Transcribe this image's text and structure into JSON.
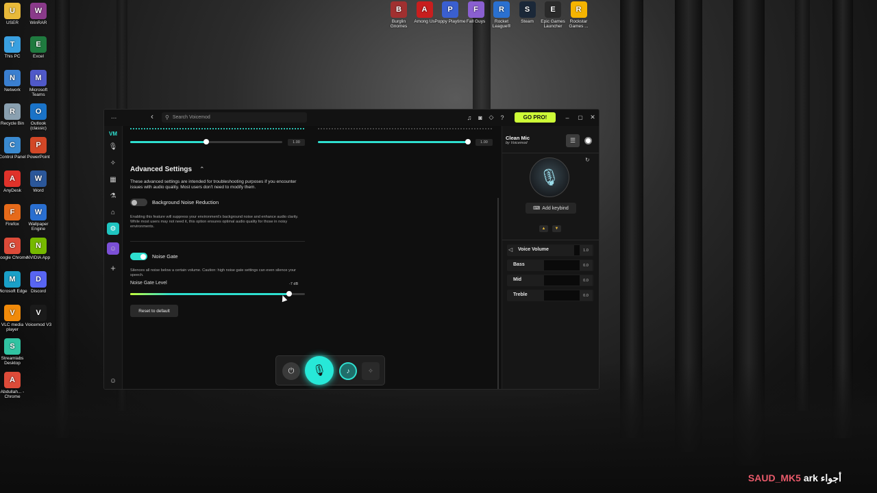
{
  "desktop": {
    "left_icons": [
      {
        "label": "USER",
        "glyph": "folder-icon",
        "color": "#e8b93a"
      },
      {
        "label": "WinRAR",
        "glyph": "winrar-icon",
        "color": "#8a3a8a"
      },
      {
        "label": "This PC",
        "glyph": "monitor-icon",
        "color": "#3aa0e0"
      },
      {
        "label": "Excel",
        "glyph": "excel-icon",
        "color": "#1f7a3f"
      },
      {
        "label": "Network",
        "glyph": "network-icon",
        "color": "#3a7fd0"
      },
      {
        "label": "Microsoft Teams",
        "glyph": "teams-icon",
        "color": "#5059c9"
      },
      {
        "label": "Recycle Bin",
        "glyph": "recycle-bin-icon",
        "color": "#8aa0b0"
      },
      {
        "label": "Outlook (classic)",
        "glyph": "outlook-icon",
        "color": "#1a73c8"
      },
      {
        "label": "Control Panel",
        "glyph": "control-panel-icon",
        "color": "#3a8ad0"
      },
      {
        "label": "PowerPoint",
        "glyph": "powerpoint-icon",
        "color": "#d24726"
      },
      {
        "label": "AnyDesk",
        "glyph": "anydesk-icon",
        "color": "#e0322a"
      },
      {
        "label": "Word",
        "glyph": "word-icon",
        "color": "#2b579a"
      },
      {
        "label": "Firefox",
        "glyph": "firefox-icon",
        "color": "#e66a1a"
      },
      {
        "label": "Wallpaper Engine",
        "glyph": "wallpaper-engine-icon",
        "color": "#2a6fd0"
      },
      {
        "label": "Google Chrome",
        "glyph": "chrome-icon",
        "color": "#dd4b39"
      },
      {
        "label": "NVIDIA App",
        "glyph": "nvidia-icon",
        "color": "#76b900"
      },
      {
        "label": "Microsoft Edge",
        "glyph": "edge-icon",
        "color": "#1aa0c8"
      },
      {
        "label": "Discord",
        "glyph": "discord-icon",
        "color": "#5865f2"
      },
      {
        "label": "VLC media player",
        "glyph": "vlc-icon",
        "color": "#f08a0a"
      },
      {
        "label": "Voicemod V3",
        "glyph": "voicemod-icon",
        "color": "#1a1a1a"
      },
      {
        "label": "Streamlabs Desktop",
        "glyph": "streamlabs-icon",
        "color": "#31c3a2"
      },
      {
        "label": "",
        "glyph": "",
        "color": ""
      },
      {
        "label": "Abdullah... - Chrome",
        "glyph": "chrome-icon",
        "color": "#dd4b39"
      }
    ],
    "top_icons": [
      {
        "label": "Burglin Gnomes",
        "color": "#a03030"
      },
      {
        "label": "Among Us",
        "color": "#c81e1e"
      },
      {
        "label": "Poppy Playtime",
        "color": "#3a5fd0"
      },
      {
        "label": "Fall Guys",
        "color": "#8a5fd0"
      },
      {
        "label": "Rocket League®",
        "color": "#2a70d0"
      },
      {
        "label": "Steam",
        "color": "#1b2838"
      },
      {
        "label": "Epic Games Launcher",
        "color": "#2a2a2a"
      },
      {
        "label": "Rockstar Games ...",
        "color": "#f5b400"
      }
    ],
    "watermark": {
      "text_red": "SAUD_MK5",
      "text_white": "ark أجواء"
    }
  },
  "app": {
    "titlebar": {
      "menu": "...",
      "back": "‹",
      "search_placeholder": "Search Voicemod",
      "go_pro": "GO PRO!",
      "help": "?"
    },
    "sliders_top": {
      "left_value": "1.00",
      "right_value": "1.00"
    },
    "advanced": {
      "title": "Advanced Settings",
      "description": "These advanced settings are intended for troubleshooting purposes if you encounter issues with audio quality. Most users don't need to modify them.",
      "bnr_label": "Background Noise Reduction",
      "bnr_description": "Enabling this feature will suppress your environment's background noise and enhance audio clarity. While most users may not need it, this option ensures optimal audio quality for those in noisy environments.",
      "noise_gate_label": "Noise Gate",
      "noise_gate_description": "Silences all noise below a certain volume. Caution: high noise gate settings can even silence your speech.",
      "noise_gate_level_label": "Noise Gate Level",
      "noise_gate_level_value": "-7 dB",
      "noise_gate_level_fraction": 0.91,
      "reset_label": "Reset to default"
    },
    "side": {
      "voice_name": "Clean Mic",
      "author": "by Voicemod",
      "add_keybind": "Add keybind",
      "rows": [
        {
          "label": "Voice Volume",
          "value": "1.0"
        },
        {
          "label": "Bass",
          "value": "0.0"
        },
        {
          "label": "Mid",
          "value": "0.0"
        },
        {
          "label": "Treble",
          "value": "0.0"
        }
      ]
    }
  }
}
